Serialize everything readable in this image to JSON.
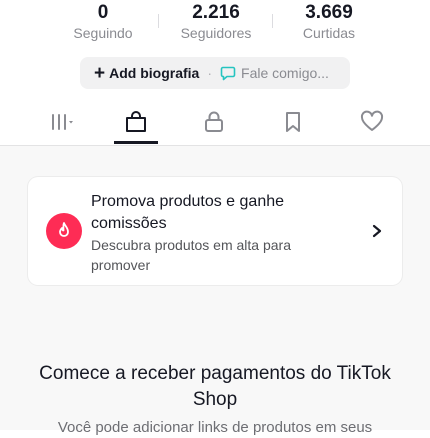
{
  "profile_stats": [
    {
      "value": "0",
      "label": "Seguindo"
    },
    {
      "value": "2.216",
      "label": "Seguidores"
    },
    {
      "value": "3.669",
      "label": "Curtidas"
    }
  ],
  "bio_bar": {
    "add_bio_label": "Add biografia",
    "separator": "·",
    "message_label": "Fale comigo..."
  },
  "tabs": [
    {
      "icon": "grid-menu-icon",
      "selected": false
    },
    {
      "icon": "shopping-bag-icon",
      "selected": true
    },
    {
      "icon": "lock-icon",
      "selected": false
    },
    {
      "icon": "bookmark-icon",
      "selected": false
    },
    {
      "icon": "heart-icon",
      "selected": false
    }
  ],
  "promo_card": {
    "title": "Promova produtos e ganhe comissões",
    "subtitle": "Descubra produtos em alta para promover",
    "icon": "flame-icon"
  },
  "shop_section": {
    "title": "Comece a receber pagamentos do TikTok Shop",
    "description": "Você pode adicionar links de produtos em seus"
  },
  "colors": {
    "accent": "#fe2c55",
    "text_primary": "#161823",
    "text_secondary": "#8a8b91",
    "message_icon": "#25c4c0"
  }
}
